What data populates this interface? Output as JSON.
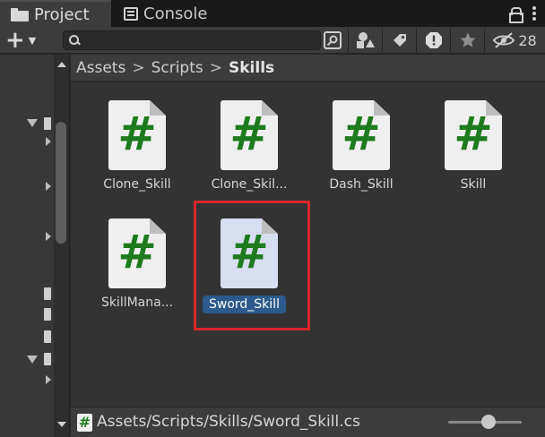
{
  "tabs": [
    {
      "label": "Project",
      "icon": "folder-icon",
      "active": true
    },
    {
      "label": "Console",
      "icon": "console-icon",
      "active": false
    }
  ],
  "toolbar": {
    "add_icon": "plus-icon",
    "search_value": "",
    "hidden_count": "28"
  },
  "breadcrumb": {
    "items": [
      "Assets",
      "Scripts"
    ],
    "current": "Skills"
  },
  "assets": [
    {
      "label": "Clone_Skill",
      "icon": "csharp-script-icon",
      "selected": false
    },
    {
      "label": "Clone_Skil...",
      "icon": "csharp-script-icon",
      "selected": false
    },
    {
      "label": "Dash_Skill",
      "icon": "csharp-script-icon",
      "selected": false
    },
    {
      "label": "Skill",
      "icon": "csharp-script-icon",
      "selected": false
    },
    {
      "label": "SkillMana...",
      "icon": "csharp-script-icon",
      "selected": false
    },
    {
      "label": "Sword_Skill",
      "icon": "csharp-script-icon",
      "selected": true
    }
  ],
  "file_glyph": "#",
  "footer": {
    "path": "Assets/Scripts/Skills/Sword_Skill.cs",
    "zoom_fraction": 0.55
  },
  "colors": {
    "selection": "#2d5a8c",
    "highlight_box": "#d8262a",
    "script_hash": "#1e7a1e"
  }
}
